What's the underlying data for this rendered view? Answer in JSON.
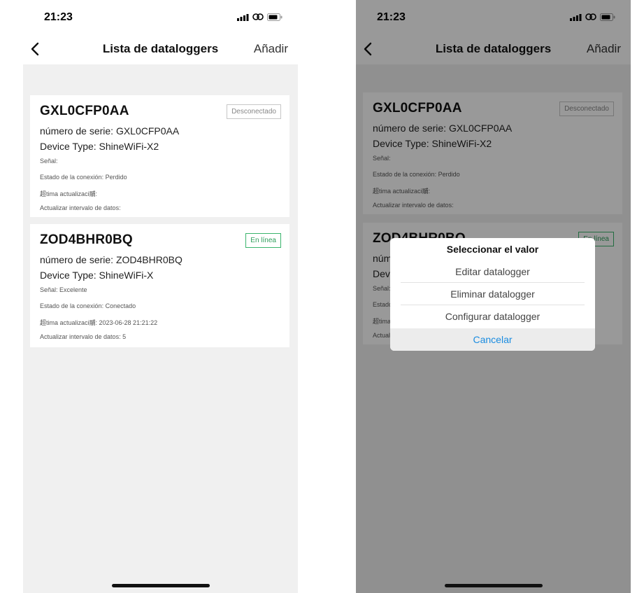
{
  "status_bar": {
    "time": "21:23"
  },
  "nav": {
    "title": "Lista de dataloggers",
    "add_label": "Añadir"
  },
  "devices": [
    {
      "name": "GXL0CFP0AA",
      "status_badge": "Desconectado",
      "serial": "número de serie: GXL0CFP0AA",
      "device_type": "Device Type: ShineWiFi-X2",
      "signal": "Señal:",
      "connection": "Estado de la conexión: Perdido",
      "last_update": "超tima actualizaci鬴:",
      "interval": "Actualizar intervalo de datos:"
    },
    {
      "name": "ZOD4BHR0BQ",
      "status_badge": "En línea",
      "serial": "número de serie: ZOD4BHR0BQ",
      "device_type": "Device Type: ShineWiFi-X",
      "signal": "Señal: Excelente",
      "connection": "Estado de la conexión: Conectado",
      "last_update": "超tima actualizaci鬴: 2023-06-28 21:21:22",
      "interval": "Actualizar intervalo de datos: 5"
    }
  ],
  "action_sheet": {
    "title": "Seleccionar el valor",
    "options": [
      "Editar datalogger",
      "Eliminar datalogger",
      "Configurar datalogger"
    ],
    "cancel": "Cancelar"
  },
  "colors": {
    "online": "#2e9e5b",
    "cancel": "#1a8ce0"
  },
  "icons": [
    "back-chevron-icon",
    "signal-icon",
    "link-icon",
    "battery-icon"
  ]
}
